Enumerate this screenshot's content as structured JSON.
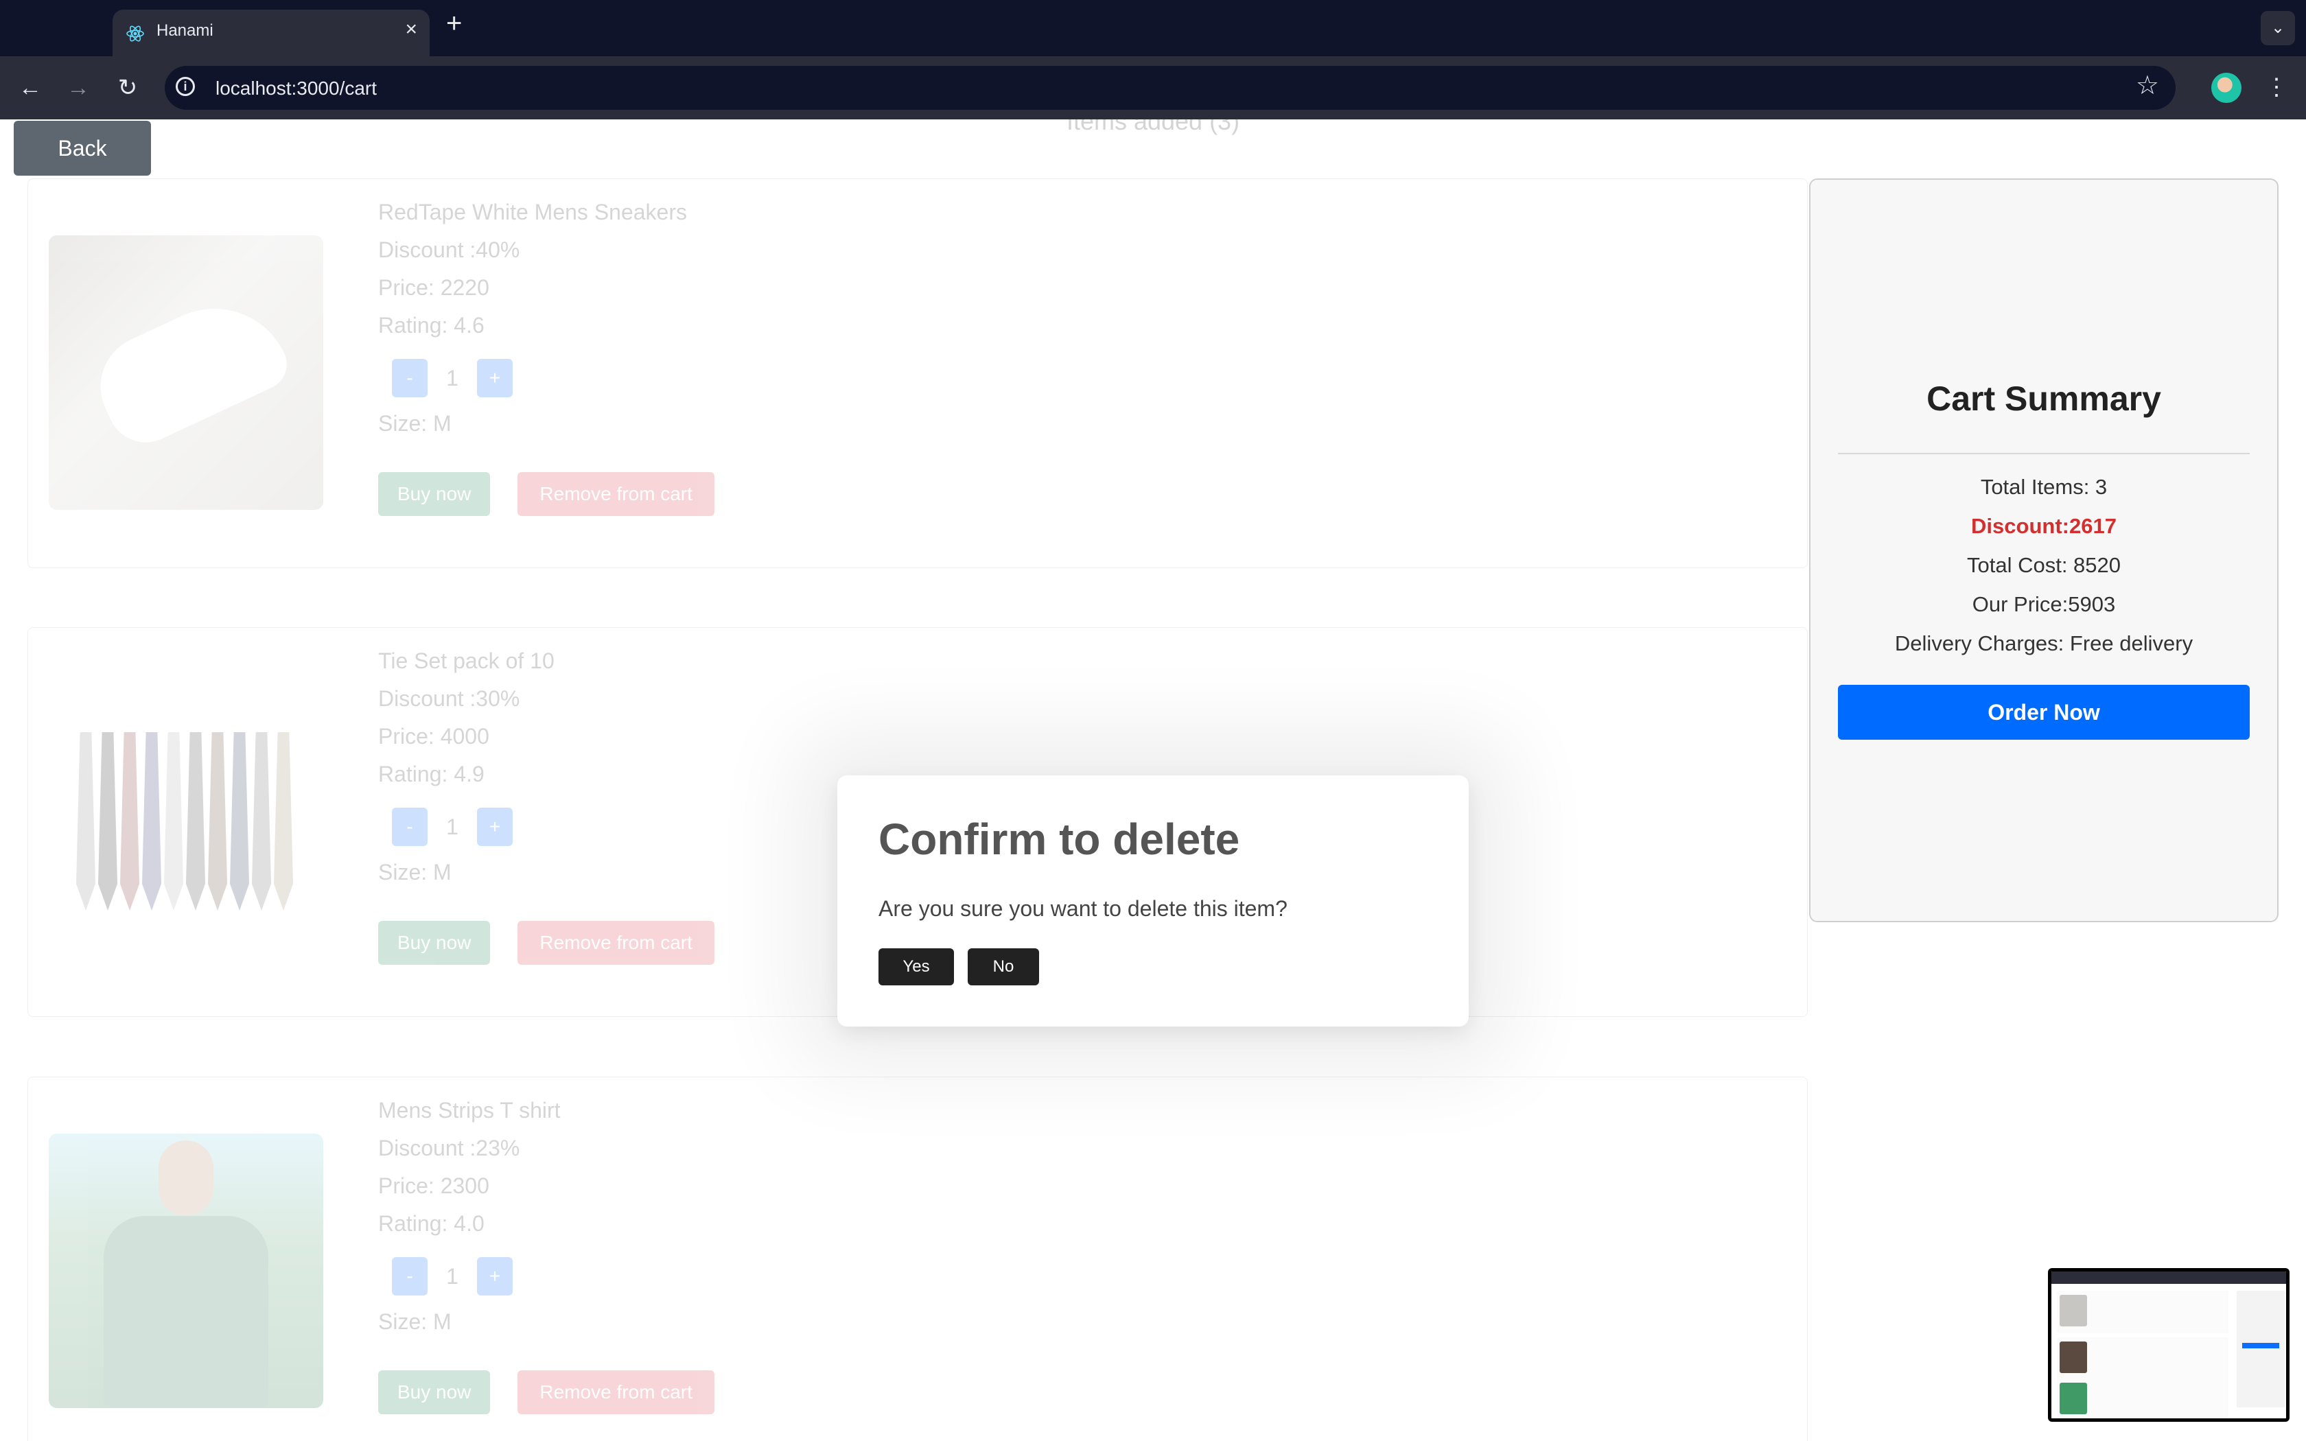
{
  "browser": {
    "tab_title": "Hanami",
    "url": "localhost:3000/cart",
    "new_tab_symbol": "+",
    "close_symbol": "×"
  },
  "page": {
    "items_heading": "Items added (3)",
    "back_label": "Back",
    "items": [
      {
        "name": "RedTape White Mens Sneakers",
        "discount": "Discount :40%",
        "price": "Price: 2220",
        "rating": "Rating: 4.6",
        "quantity": "1",
        "size": "Size: M",
        "image": "white-sneakers"
      },
      {
        "name": "Tie Set pack of 10",
        "discount": "Discount :30%",
        "price": "Price: 4000",
        "rating": "Rating: 4.9",
        "quantity": "1",
        "size": "Size: M",
        "image": "tie-set"
      },
      {
        "name": "Mens Strips T shirt",
        "discount": "Discount :23%",
        "price": "Price: 2300",
        "rating": "Rating: 4.0",
        "quantity": "1",
        "size": "Size: M",
        "image": "striped-tshirt"
      }
    ],
    "buttons": {
      "minus": "-",
      "plus": "+",
      "buy_now": "Buy now",
      "remove": "Remove from cart"
    }
  },
  "summary": {
    "title": "Cart Summary",
    "total_items": "Total Items: 3",
    "discount": "Discount:2617",
    "total_cost": "Total Cost: 8520",
    "our_price": "Our Price:5903",
    "delivery": "Delivery Charges: Free delivery",
    "order_button": "Order Now"
  },
  "dialog": {
    "title": "Confirm to delete",
    "message": "Are you sure you want to delete this item?",
    "yes": "Yes",
    "no": "No"
  },
  "colors": {
    "browser_bg": "#10142a",
    "toolbar_bg": "#2b2d3a",
    "primary": "#0d6efd",
    "order_button": "#006cff",
    "success": "#198754",
    "danger": "#dc3545",
    "discount_text": "#d32f2f"
  }
}
